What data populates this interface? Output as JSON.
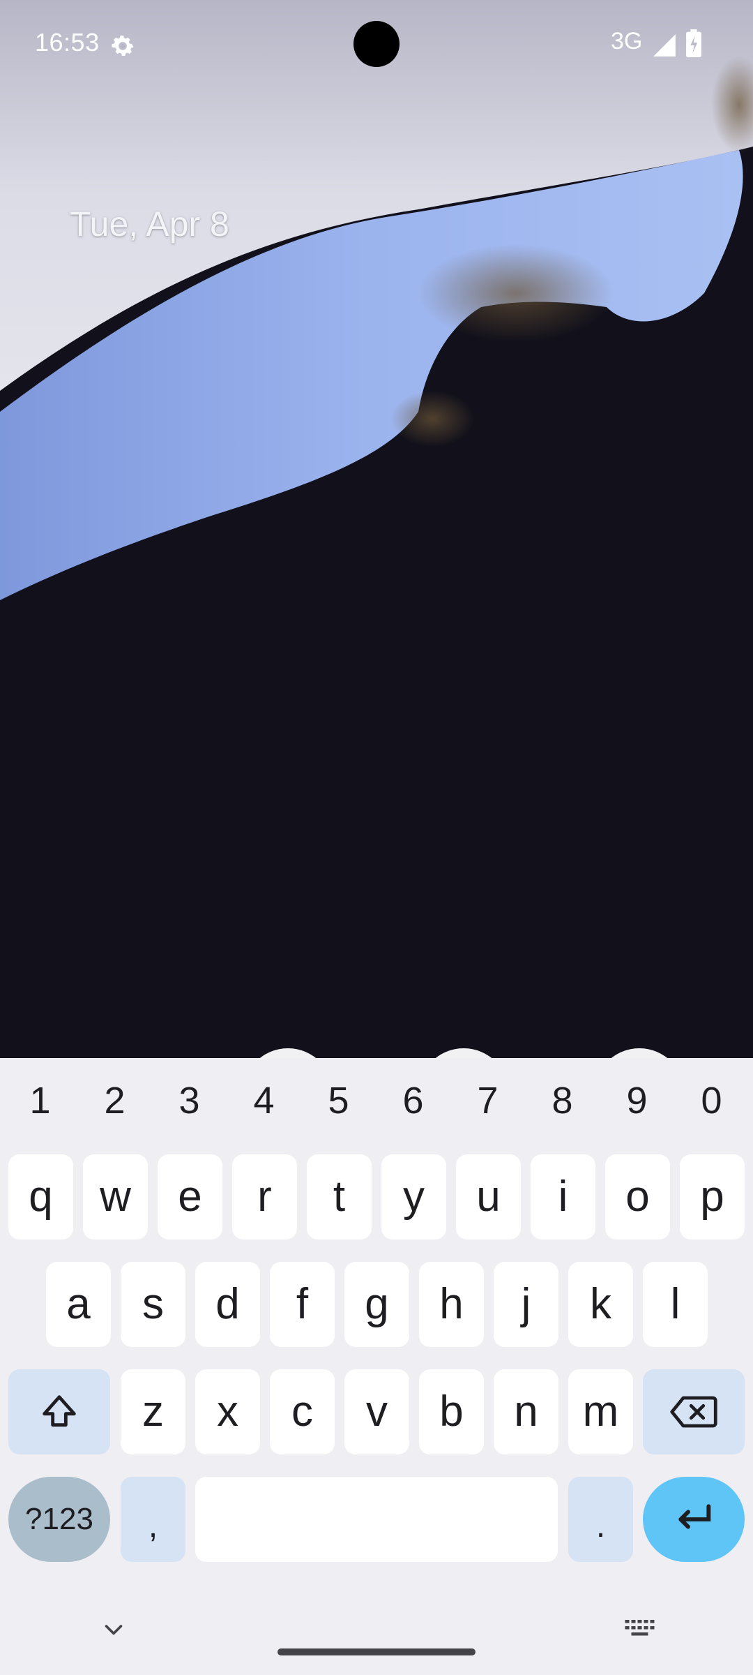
{
  "status_bar": {
    "time": "16:53",
    "network": "3G",
    "icons": [
      "settings-icon",
      "signal-icon",
      "battery-charging-icon"
    ]
  },
  "lockscreen": {
    "date": "Tue, Apr 8"
  },
  "keyboard": {
    "number_row": [
      "1",
      "2",
      "3",
      "4",
      "5",
      "6",
      "7",
      "8",
      "9",
      "0"
    ],
    "row1": [
      "q",
      "w",
      "e",
      "r",
      "t",
      "y",
      "u",
      "i",
      "o",
      "p"
    ],
    "row2": [
      "a",
      "s",
      "d",
      "f",
      "g",
      "h",
      "j",
      "k",
      "l"
    ],
    "row3": [
      "z",
      "x",
      "c",
      "v",
      "b",
      "n",
      "m"
    ],
    "symbols_key": "?123",
    "comma_key": ",",
    "period_key": ".",
    "icons": {
      "shift": "shift-icon",
      "backspace": "backspace-icon",
      "enter": "enter-icon",
      "hide": "chevron-down-icon",
      "switch": "keyboard-icon"
    },
    "colors": {
      "background": "#efeff3",
      "key": "#ffffff",
      "modifier": "#d5e3f4",
      "symbols": "#aabdcb",
      "enter": "#5fc4f6"
    }
  }
}
